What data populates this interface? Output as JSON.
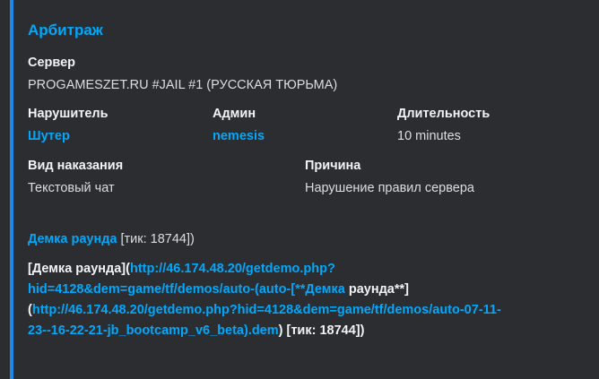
{
  "embed": {
    "accent_color": "#1e88e5",
    "title": "Арбитраж",
    "server": {
      "label": "Сервер",
      "value": "PROGAMESZET.RU #JAIL #1 (РУССКАЯ ТЮРЬМА)"
    },
    "fields_row1": [
      {
        "label": "Нарушитель",
        "value": "Шутер"
      },
      {
        "label": "Админ",
        "value": "nemesis"
      },
      {
        "label": "Длительность",
        "value": "10 minutes"
      }
    ],
    "fields_row2": [
      {
        "label": "Вид наказания",
        "value": "Текстовый чат"
      },
      {
        "label": "Причина",
        "value": "Нарушение правил сервера"
      }
    ],
    "demo": {
      "link_text": "Демка раунда",
      "tick_text": "[тик: 18744])"
    },
    "raw_markdown": {
      "line1_prefix": "[Демка раунда](",
      "line1_url": "http://46.174.48.20/getdemo.php?",
      "line2_url": "hid=4128&dem=game/tf/demos/auto-(auto-[**Демка",
      "line2_suffix": " раунда**]",
      "line3_prefix": "(",
      "line3_url": "http://46.174.48.20/getdemo.php?hid=4128&dem=game/tf/demos/auto-07-11-",
      "line4_url": "23--16-22-21-jb_bootcamp_v6_beta).dem",
      "line4_suffix": ") [тик: 18744])"
    }
  }
}
